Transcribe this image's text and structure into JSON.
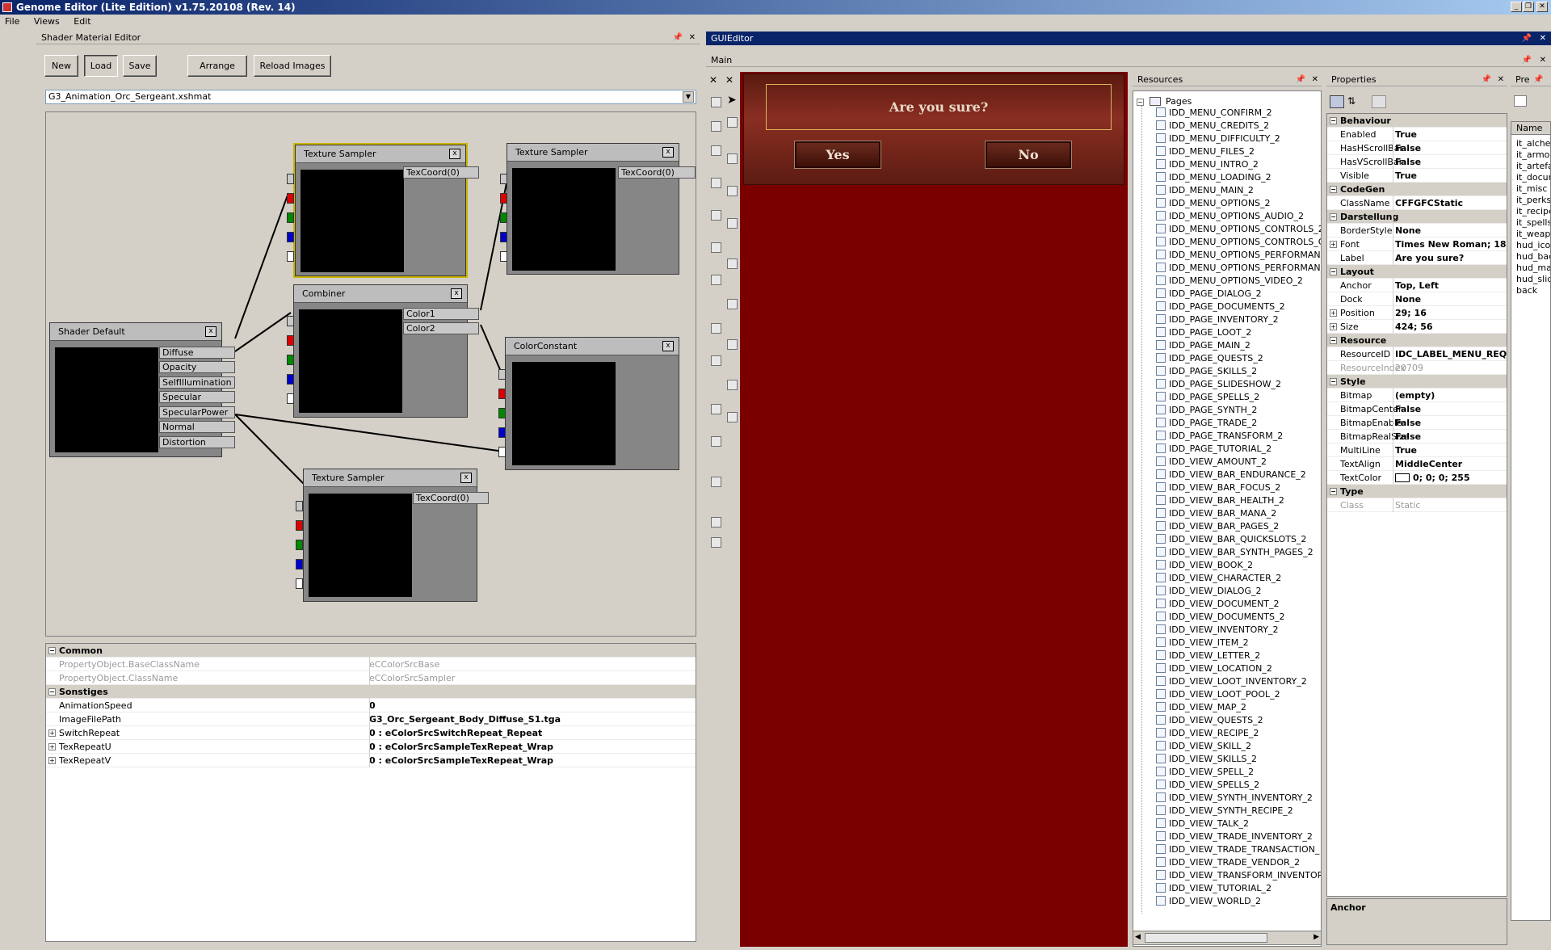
{
  "app": {
    "title": "Genome Editor (Lite Edition) v1.75.20108 (Rev. 14)"
  },
  "menu": [
    "File",
    "Views",
    "Edit"
  ],
  "shader_panel": {
    "title": "Shader Material Editor",
    "buttons": {
      "new": "New",
      "load": "Load",
      "save": "Save",
      "arrange": "Arrange",
      "reload": "Reload Images"
    },
    "file": "G3_Animation_Orc_Sergeant.xshmat",
    "nodes": {
      "ts1": {
        "title": "Texture Sampler",
        "out": "TexCoord(0)"
      },
      "ts2": {
        "title": "Texture Sampler",
        "out": "TexCoord(0)"
      },
      "ts3": {
        "title": "Texture Sampler",
        "out": "TexCoord(0)"
      },
      "combiner": {
        "title": "Combiner",
        "out1": "Color1",
        "out2": "Color2"
      },
      "colorconst": {
        "title": "ColorConstant"
      },
      "shader": {
        "title": "Shader Default",
        "inputs": [
          "Diffuse",
          "Opacity",
          "SelfIllumination",
          "Specular",
          "SpecularPower",
          "Normal",
          "Distortion"
        ]
      }
    },
    "close_glyph": "x",
    "props": {
      "cat_common": "Common",
      "base_k": "PropertyObject.BaseClassName",
      "base_v": "eCColorSrcBase",
      "class_k": "PropertyObject.ClassName",
      "class_v": "eCColorSrcSampler",
      "cat_sonstiges": "Sonstiges",
      "anim_k": "AnimationSpeed",
      "anim_v": "0",
      "img_k": "ImageFilePath",
      "img_v": "G3_Orc_Sergeant_Body_Diffuse_S1.tga",
      "sw_k": "SwitchRepeat",
      "sw_v": "0 : eColorSrcSwitchRepeat_Repeat",
      "tu_k": "TexRepeatU",
      "tu_v": "0 : eColorSrcSampleTexRepeat_Wrap",
      "tv_k": "TexRepeatV",
      "tv_v": "0 : eColorSrcSampleTexRepeat_Wrap"
    }
  },
  "gui_panel": {
    "title": "GUIEditor",
    "tab": "Main",
    "dialog": {
      "question": "Are you sure?",
      "yes": "Yes",
      "no": "No"
    }
  },
  "resources": {
    "title": "Resources",
    "root": "Pages",
    "items": [
      "IDD_MENU_CONFIRM_2",
      "IDD_MENU_CREDITS_2",
      "IDD_MENU_DIFFICULTY_2",
      "IDD_MENU_FILES_2",
      "IDD_MENU_INTRO_2",
      "IDD_MENU_LOADING_2",
      "IDD_MENU_MAIN_2",
      "IDD_MENU_OPTIONS_2",
      "IDD_MENU_OPTIONS_AUDIO_2",
      "IDD_MENU_OPTIONS_CONTROLS_2",
      "IDD_MENU_OPTIONS_CONTROLS_C",
      "IDD_MENU_OPTIONS_PERFORMANC",
      "IDD_MENU_OPTIONS_PERFORMANC",
      "IDD_MENU_OPTIONS_VIDEO_2",
      "IDD_PAGE_DIALOG_2",
      "IDD_PAGE_DOCUMENTS_2",
      "IDD_PAGE_INVENTORY_2",
      "IDD_PAGE_LOOT_2",
      "IDD_PAGE_MAIN_2",
      "IDD_PAGE_QUESTS_2",
      "IDD_PAGE_SKILLS_2",
      "IDD_PAGE_SLIDESHOW_2",
      "IDD_PAGE_SPELLS_2",
      "IDD_PAGE_SYNTH_2",
      "IDD_PAGE_TRADE_2",
      "IDD_PAGE_TRANSFORM_2",
      "IDD_PAGE_TUTORIAL_2",
      "IDD_VIEW_AMOUNT_2",
      "IDD_VIEW_BAR_ENDURANCE_2",
      "IDD_VIEW_BAR_FOCUS_2",
      "IDD_VIEW_BAR_HEALTH_2",
      "IDD_VIEW_BAR_MANA_2",
      "IDD_VIEW_BAR_PAGES_2",
      "IDD_VIEW_BAR_QUICKSLOTS_2",
      "IDD_VIEW_BAR_SYNTH_PAGES_2",
      "IDD_VIEW_BOOK_2",
      "IDD_VIEW_CHARACTER_2",
      "IDD_VIEW_DIALOG_2",
      "IDD_VIEW_DOCUMENT_2",
      "IDD_VIEW_DOCUMENTS_2",
      "IDD_VIEW_INVENTORY_2",
      "IDD_VIEW_ITEM_2",
      "IDD_VIEW_LETTER_2",
      "IDD_VIEW_LOCATION_2",
      "IDD_VIEW_LOOT_INVENTORY_2",
      "IDD_VIEW_LOOT_POOL_2",
      "IDD_VIEW_MAP_2",
      "IDD_VIEW_QUESTS_2",
      "IDD_VIEW_RECIPE_2",
      "IDD_VIEW_SKILL_2",
      "IDD_VIEW_SKILLS_2",
      "IDD_VIEW_SPELL_2",
      "IDD_VIEW_SPELLS_2",
      "IDD_VIEW_SYNTH_INVENTORY_2",
      "IDD_VIEW_SYNTH_RECIPE_2",
      "IDD_VIEW_TALK_2",
      "IDD_VIEW_TRADE_INVENTORY_2",
      "IDD_VIEW_TRADE_TRANSACTION_",
      "IDD_VIEW_TRADE_VENDOR_2",
      "IDD_VIEW_TRANSFORM_INVENTOR",
      "IDD_VIEW_TUTORIAL_2",
      "IDD_VIEW_WORLD_2"
    ]
  },
  "properties": {
    "title": "Properties",
    "rows": [
      {
        "cat": "Behaviour"
      },
      {
        "k": "Enabled",
        "v": "True"
      },
      {
        "k": "HasHScrollBar",
        "v": "False"
      },
      {
        "k": "HasVScrollBar",
        "v": "False"
      },
      {
        "k": "Visible",
        "v": "True"
      },
      {
        "cat": "CodeGen"
      },
      {
        "k": "ClassName",
        "v": "CFFGFCStatic"
      },
      {
        "cat": "Darstellung"
      },
      {
        "k": "BorderStyle",
        "v": "None"
      },
      {
        "k": "Font",
        "v": "Times New Roman; 18",
        "exp": true
      },
      {
        "k": "Label",
        "v": "Are you sure?"
      },
      {
        "cat": "Layout"
      },
      {
        "k": "Anchor",
        "v": "Top, Left"
      },
      {
        "k": "Dock",
        "v": "None"
      },
      {
        "k": "Position",
        "v": "29; 16",
        "exp": true
      },
      {
        "k": "Size",
        "v": "424; 56",
        "exp": true
      },
      {
        "cat": "Resource"
      },
      {
        "k": "ResourceID",
        "v": "IDC_LABEL_MENU_REQU"
      },
      {
        "k": "ResourceIndex",
        "v": "20709",
        "gray": true
      },
      {
        "cat": "Style"
      },
      {
        "k": "Bitmap",
        "v": "(empty)"
      },
      {
        "k": "BitmapCenter",
        "v": "False"
      },
      {
        "k": "BitmapEnable",
        "v": "False"
      },
      {
        "k": "BitmapRealSize",
        "v": "False"
      },
      {
        "k": "MultiLine",
        "v": "True"
      },
      {
        "k": "TextAlign",
        "v": "MiddleCenter"
      },
      {
        "k": "TextColor",
        "v": "0; 0; 0; 255",
        "swatch": true
      },
      {
        "cat": "Type"
      },
      {
        "k": "Class",
        "v": "Static",
        "gray": true
      }
    ],
    "desc": "Anchor"
  },
  "preview": {
    "title": "Pre",
    "col": "Name",
    "items": [
      "it_alchem",
      "it_armor",
      "it_artefac",
      "it_docume",
      "it_misc",
      "it_perks",
      "it_recipe",
      "it_spells",
      "it_weapon",
      "hud_icons",
      "hud_back",
      "hud_maps",
      "hud_slides",
      "back"
    ]
  },
  "colors": {
    "accent": "#0a246a",
    "dialog_red": "#7a0000",
    "node_select": "#c8b400"
  }
}
